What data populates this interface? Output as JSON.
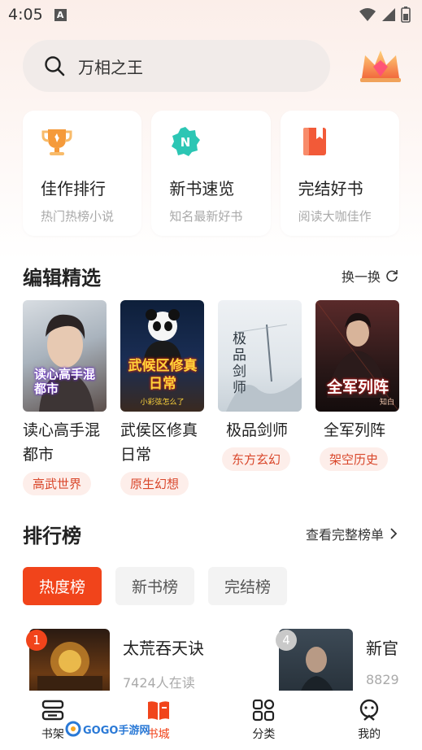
{
  "status_bar": {
    "time": "4:05",
    "a_glyph": "A"
  },
  "search": {
    "query": "万相之王"
  },
  "quick_links": [
    {
      "title": "佳作排行",
      "subtitle": "热门热榜小说",
      "icon": "trophy-icon",
      "color": "#f59a3a"
    },
    {
      "title": "新书速览",
      "subtitle": "知名最新好书",
      "icon": "new-badge-icon",
      "color": "#2cc6b4"
    },
    {
      "title": "完结好书",
      "subtitle": "阅读大咖佳作",
      "icon": "book-icon",
      "color": "#f25a38"
    }
  ],
  "editor_picks": {
    "title": "编辑精选",
    "action": "换一换",
    "books": [
      {
        "title": "读心高手混都市",
        "tag": "高武世界",
        "cover_text": "读心高手混都市"
      },
      {
        "title": "武侯区修真日常",
        "tag": "原生幻想",
        "cover_text": "武候区修真日常",
        "cover_sub": "小彩弦怎么了"
      },
      {
        "title": "极品剑师",
        "tag": "东方玄幻",
        "cover_text": "极品剑师"
      },
      {
        "title": "全军列阵",
        "tag": "架空历史",
        "cover_text": "全军列阵",
        "cover_sub": "知白"
      }
    ]
  },
  "rankings": {
    "title": "排行榜",
    "action": "查看完整榜单",
    "tabs": [
      "热度榜",
      "新书榜",
      "完结榜"
    ],
    "active_tab": 0,
    "items": [
      {
        "rank": "1",
        "name": "太荒吞天诀",
        "count": "7424人在读"
      },
      {
        "rank": "4",
        "name": "新官",
        "count": "8829"
      }
    ]
  },
  "bottom_nav": [
    {
      "label": "书架",
      "icon": "bookshelf-icon"
    },
    {
      "label": "书城",
      "icon": "bookstore-icon",
      "active": true
    },
    {
      "label": "分类",
      "icon": "category-grid-icon"
    },
    {
      "label": "我的",
      "icon": "profile-icon"
    }
  ],
  "watermark": {
    "brand": "GOGO手游网",
    "url": "GOGO.com"
  },
  "colors": {
    "accent": "#f1441b",
    "tag_bg": "#fdeeea",
    "tag_text": "#d9472b"
  }
}
